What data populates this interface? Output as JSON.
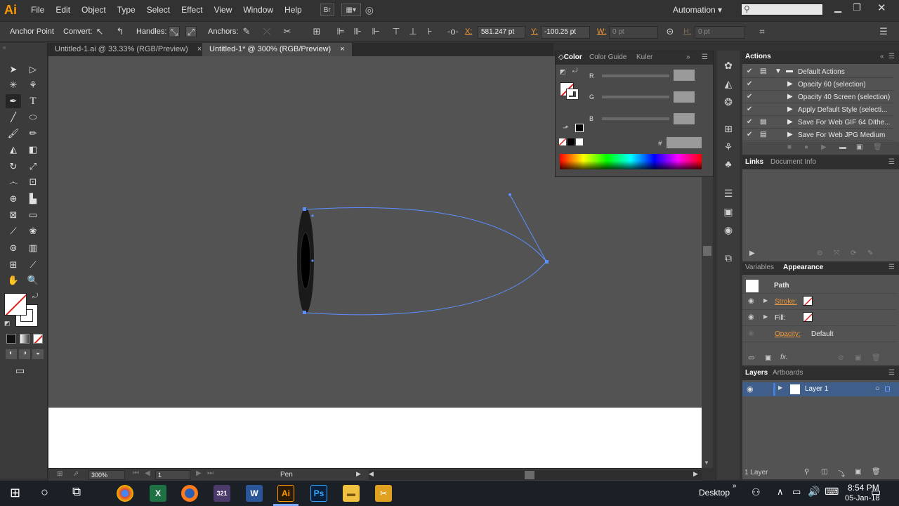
{
  "app": {
    "logo": "Ai"
  },
  "menu": {
    "items": [
      "File",
      "Edit",
      "Object",
      "Type",
      "Select",
      "Effect",
      "View",
      "Window",
      "Help"
    ],
    "br_label": "Br",
    "workspace": "Automation",
    "search_placeholder": ""
  },
  "controlbar": {
    "tool_label": "Anchor Point",
    "convert_label": "Convert:",
    "handles_label": "Handles:",
    "anchors_label": "Anchors:",
    "x_label": "X:",
    "x_value": "581.247 pt",
    "y_label": "Y:",
    "y_value": "-100.25 pt",
    "w_label": "W:",
    "w_value": "0 pt",
    "h_label": "H:",
    "h_value": "0 pt"
  },
  "tabs": [
    {
      "label": "Untitled-1.ai @ 33.33% (RGB/Preview)",
      "close": "×"
    },
    {
      "label": "Untitled-1* @ 300% (RGB/Preview)",
      "close": "×"
    }
  ],
  "color_panel": {
    "tabs": [
      "Color",
      "Color Guide",
      "Kuler"
    ],
    "channels": [
      "R",
      "G",
      "B"
    ],
    "hex_label": "#"
  },
  "actions_panel": {
    "title": "Actions",
    "set_name": "Default Actions",
    "items": [
      "Opacity 60 (selection)",
      "Opacity 40 Screen (selection)",
      "Apply Default Style (selecti...",
      "Save For Web GIF 64 Dithe...",
      "Save For Web JPG Medium"
    ]
  },
  "links_panel": {
    "tabs": [
      "Links",
      "Document Info"
    ]
  },
  "appearance_panel": {
    "tabs": [
      "Variables",
      "Appearance"
    ],
    "object": "Path",
    "stroke_label": "Stroke:",
    "fill_label": "Fill:",
    "opacity_label": "Opacity:",
    "opacity_value": "Default",
    "fx_label": "fx."
  },
  "layers_panel": {
    "tabs": [
      "Layers",
      "Artboards"
    ],
    "layer_name": "Layer 1",
    "footer": "1 Layer"
  },
  "status": {
    "zoom": "300%",
    "page": "1",
    "tool": "Pen"
  },
  "taskbar": {
    "desktop": "Desktop",
    "time": "8:54 PM",
    "date": "05-Jan-18"
  },
  "colors": {
    "accent": "#ff9a00",
    "path": "#5b8fff",
    "canvas": "#535353"
  }
}
